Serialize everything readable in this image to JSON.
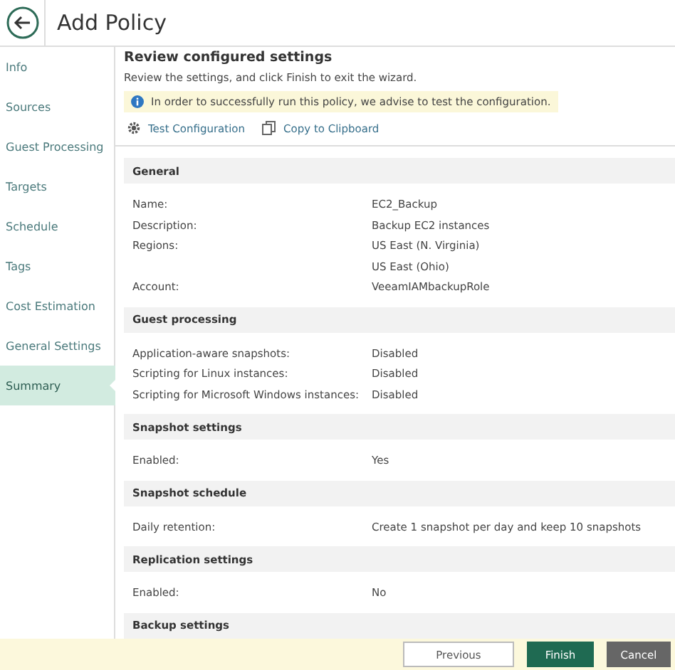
{
  "header": {
    "title": "Add Policy"
  },
  "sidebar": {
    "items": [
      {
        "label": "Info",
        "selected": false
      },
      {
        "label": "Sources",
        "selected": false
      },
      {
        "label": "Guest Processing",
        "selected": false
      },
      {
        "label": "Targets",
        "selected": false
      },
      {
        "label": "Schedule",
        "selected": false
      },
      {
        "label": "Tags",
        "selected": false
      },
      {
        "label": "Cost Estimation",
        "selected": false
      },
      {
        "label": "General Settings",
        "selected": false
      },
      {
        "label": "Summary",
        "selected": true
      }
    ]
  },
  "content": {
    "heading": "Review configured settings",
    "subtitle": "Review the settings, and click Finish to exit the wizard.",
    "notice": "In order to successfully run this policy, we advise to test the configuration.",
    "actions": [
      {
        "label": "Test Configuration",
        "kind": "gear"
      },
      {
        "label": "Copy to Clipboard",
        "kind": "copy"
      }
    ],
    "sections": [
      {
        "title": "General",
        "rows": [
          {
            "label": "Name:",
            "values": [
              "EC2_Backup"
            ]
          },
          {
            "label": "Description:",
            "values": [
              "Backup EC2 instances"
            ]
          },
          {
            "label": "Regions:",
            "values": [
              "US East (N. Virginia)",
              "US East (Ohio)"
            ]
          },
          {
            "label": "Account:",
            "values": [
              "VeeamIAMbackupRole"
            ]
          }
        ]
      },
      {
        "title": "Guest processing",
        "rows": [
          {
            "label": "Application-aware snapshots:",
            "values": [
              "Disabled"
            ]
          },
          {
            "label": "Scripting for Linux instances:",
            "values": [
              "Disabled"
            ]
          },
          {
            "label": "Scripting for Microsoft Windows instances:",
            "values": [
              "Disabled"
            ]
          }
        ]
      },
      {
        "title": "Snapshot settings",
        "rows": [
          {
            "label": "Enabled:",
            "values": [
              "Yes"
            ]
          }
        ]
      },
      {
        "title": "Snapshot schedule",
        "rows": [
          {
            "label": "Daily retention:",
            "values": [
              "Create 1 snapshot per day and keep 10 snapshots"
            ]
          }
        ]
      },
      {
        "title": "Replication settings",
        "rows": [
          {
            "label": "Enabled:",
            "values": [
              "No"
            ]
          }
        ]
      },
      {
        "title": "Backup settings"
      }
    ]
  },
  "footer": {
    "buttons": [
      {
        "label": "Previous",
        "kind": "secondary"
      },
      {
        "label": "Finish",
        "kind": "primary"
      },
      {
        "label": "Cancel",
        "kind": "cancel"
      }
    ]
  }
}
